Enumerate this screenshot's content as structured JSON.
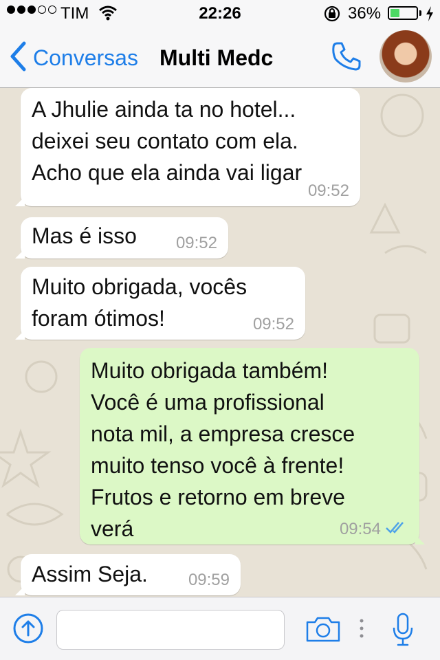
{
  "status_bar": {
    "carrier": "TIM",
    "time": "22:26",
    "battery": "36%",
    "battery_level": 0.36,
    "signal_bars_filled": 3,
    "signal_bars_total": 5
  },
  "nav": {
    "back_label": "Conversas",
    "title": "Multi Medc",
    "accent_color": "#1e7ee8"
  },
  "messages": [
    {
      "direction": "in",
      "text": "A Jhulie ainda ta no hotel...\ndeixei seu contato com ela.\nAcho que ela ainda vai ligar",
      "time": "09:52"
    },
    {
      "direction": "in",
      "text": "Mas é isso",
      "time": "09:52"
    },
    {
      "direction": "in",
      "text": "Muito obrigada, vocês\nforam ótimos!",
      "time": "09:52"
    },
    {
      "direction": "out",
      "text": "Muito obrigada também!\nVocê é uma profissional\nnota mil, a empresa cresce\nmuito tenso você à frente!\nFrutos e retorno em breve\nverá",
      "time": "09:54",
      "status": "read"
    },
    {
      "direction": "in",
      "text": "Assim Seja.",
      "time": "09:59"
    }
  ],
  "input": {
    "placeholder": ""
  },
  "colors": {
    "incoming_bubble": "#ffffff",
    "outgoing_bubble": "#dcf8c6",
    "chat_background": "#e8e2d6",
    "read_ticks": "#4fa3e8"
  }
}
